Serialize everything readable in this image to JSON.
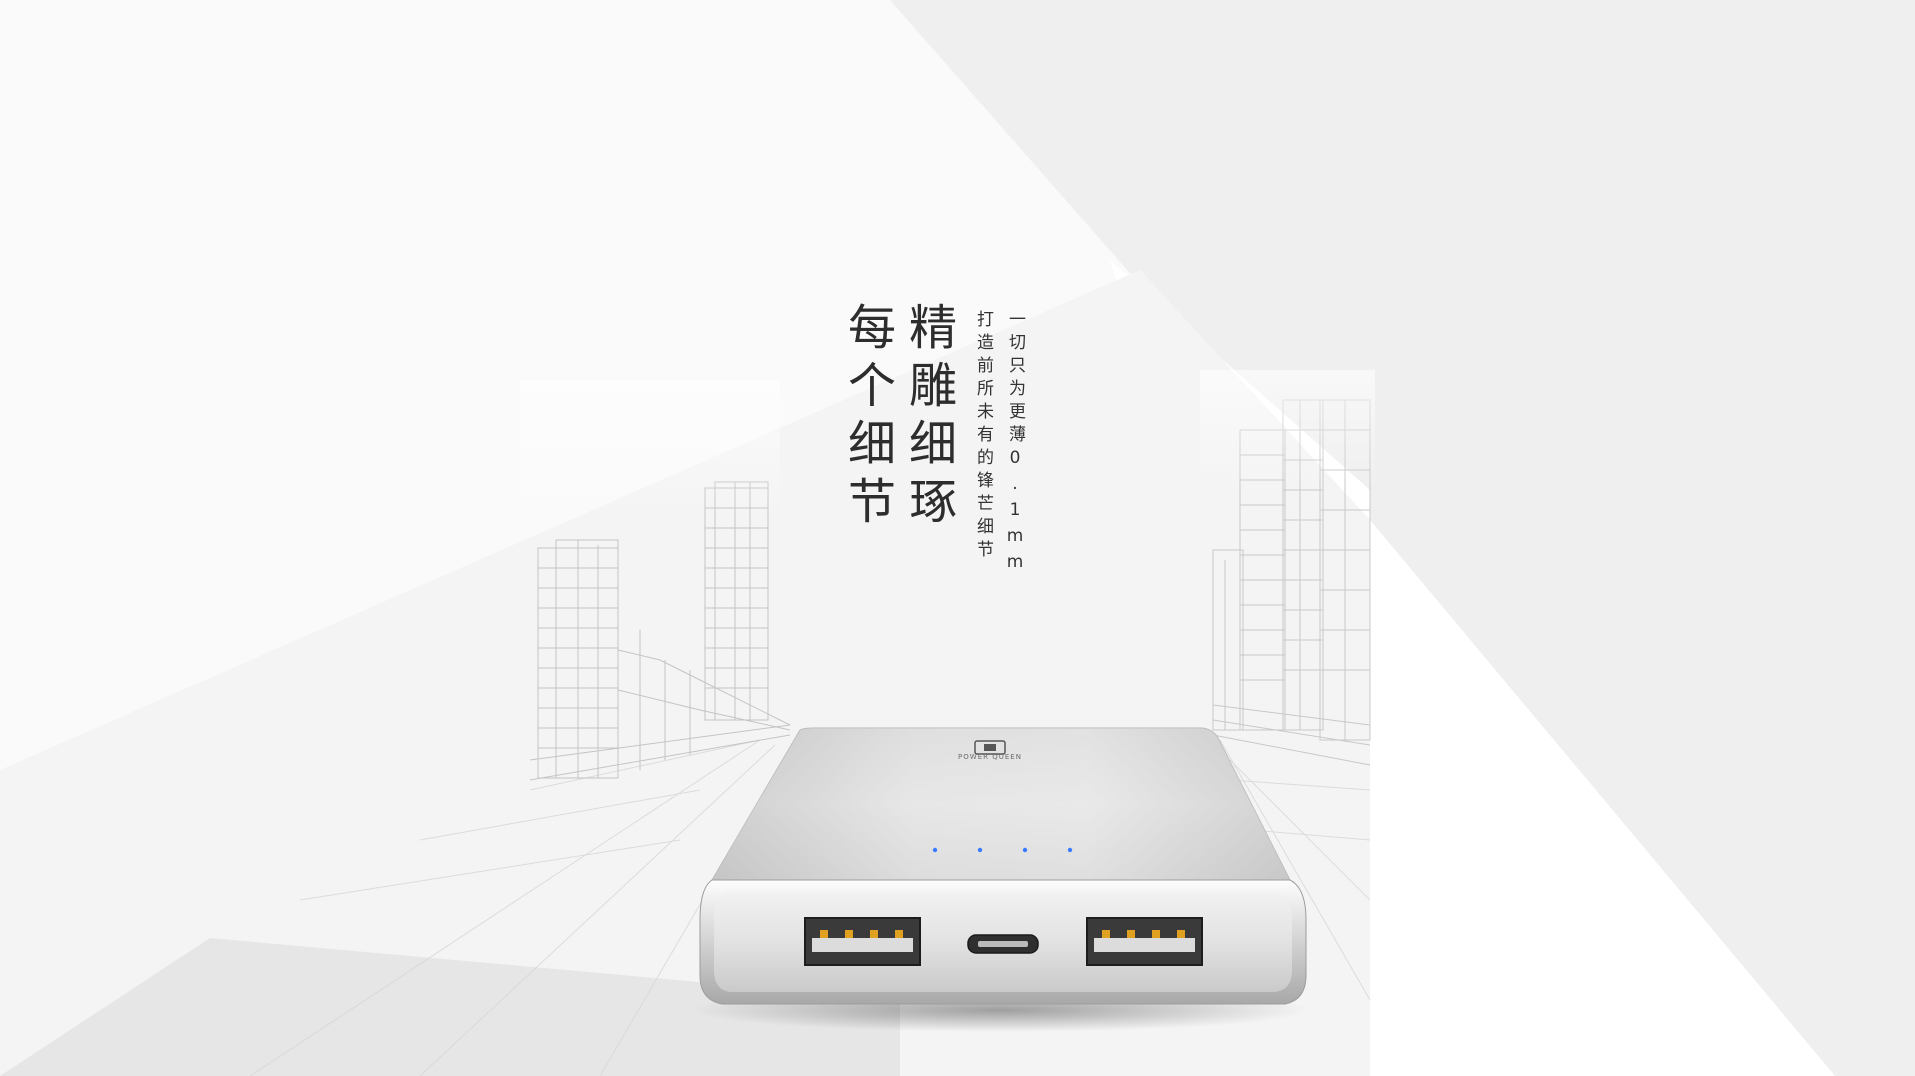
{
  "headline": {
    "line1": "每个细节",
    "line2": "精雕细琢"
  },
  "tagline": {
    "line1": "打造前所未有的锋芒细节",
    "line2": "一切只为更薄0.1mm"
  },
  "product": {
    "brand_text": "POWER QUEEN",
    "indicator_count": 4,
    "indicator_color": "#3b7bff",
    "body_color": "#c9c9c9"
  },
  "background": {
    "base_color": "#fafafa",
    "triangle_color": "#efefef",
    "floor_color": "#e4e4e4"
  }
}
